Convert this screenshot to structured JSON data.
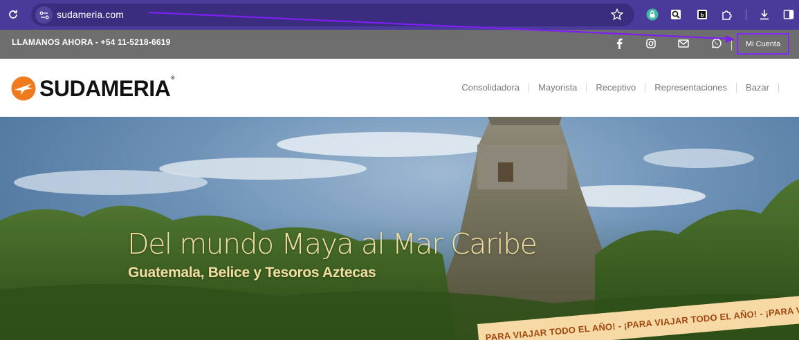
{
  "browser": {
    "url": "sudameria.com",
    "icons": [
      "reload-icon",
      "site-info-icon",
      "bookmark-star-icon",
      "extension-lock-icon",
      "extension-search-icon",
      "extension-b-icon",
      "extensions-puzzle-icon",
      "download-icon",
      "side-panel-icon"
    ]
  },
  "info_strip": {
    "phone": "LLAMANOS AHORA - +54 11-5218-6619",
    "account_label": "Mi Cuenta",
    "social_icons": [
      "facebook-icon",
      "instagram-icon",
      "mail-icon",
      "whatsapp-icon"
    ]
  },
  "header": {
    "logo_text": "SUDAMERIA",
    "logo_reg": "®",
    "nav": [
      {
        "label": "Consolidadora"
      },
      {
        "label": "Mayorista"
      },
      {
        "label": "Receptivo"
      },
      {
        "label": "Representaciones"
      },
      {
        "label": "Bazar"
      }
    ]
  },
  "hero": {
    "title": "Del mundo Maya al Mar Caribe",
    "subtitle": "Guatemala, Belice y Tesoros Aztecas",
    "promo": "PARA VIAJAR TODO EL AÑO! - ¡PARA VIAJAR TODO EL AÑO! - ¡PARA VIAJAR TODO EL AÑO! -"
  },
  "colors": {
    "browser_bar": "#4a3a9a",
    "address_pill": "#3a2c7e",
    "info_strip": "#6e6e6e",
    "highlight": "#7d2cf0",
    "logo_orange": "#f07a1e",
    "hero_text": "#f2dea0",
    "promo_bg": "#f7d9a6",
    "promo_text": "#a0480e"
  }
}
